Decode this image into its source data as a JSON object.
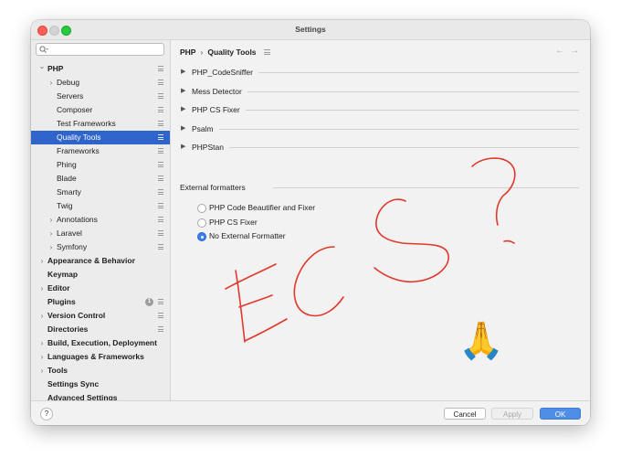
{
  "window": {
    "title": "Settings"
  },
  "sidebar": {
    "search_placeholder": "",
    "items": [
      {
        "label": "PHP",
        "bold": true,
        "arrow": "open",
        "depth": 0,
        "page": true
      },
      {
        "label": "Debug",
        "arrow": "closed",
        "depth": 1,
        "page": true
      },
      {
        "label": "Servers",
        "depth": 1,
        "page": true
      },
      {
        "label": "Composer",
        "depth": 1,
        "page": true
      },
      {
        "label": "Test Frameworks",
        "depth": 1,
        "page": true
      },
      {
        "label": "Quality Tools",
        "depth": 1,
        "page": true,
        "selected": true
      },
      {
        "label": "Frameworks",
        "depth": 1,
        "page": true
      },
      {
        "label": "Phing",
        "depth": 1,
        "page": true
      },
      {
        "label": "Blade",
        "depth": 1,
        "page": true
      },
      {
        "label": "Smarty",
        "depth": 1,
        "page": true
      },
      {
        "label": "Twig",
        "depth": 1,
        "page": true
      },
      {
        "label": "Annotations",
        "arrow": "closed",
        "depth": 1,
        "page": true
      },
      {
        "label": "Laravel",
        "arrow": "closed",
        "depth": 1,
        "page": true
      },
      {
        "label": "Symfony",
        "arrow": "closed",
        "depth": 1,
        "page": true
      },
      {
        "label": "Appearance & Behavior",
        "bold": true,
        "arrow": "closed",
        "depth": 0
      },
      {
        "label": "Keymap",
        "bold": true,
        "depth": 0
      },
      {
        "label": "Editor",
        "bold": true,
        "arrow": "closed",
        "depth": 0
      },
      {
        "label": "Plugins",
        "bold": true,
        "depth": 0,
        "page": true,
        "badge": "1"
      },
      {
        "label": "Version Control",
        "bold": true,
        "arrow": "closed",
        "depth": 0,
        "page": true
      },
      {
        "label": "Directories",
        "bold": true,
        "depth": 0,
        "page": true
      },
      {
        "label": "Build, Execution, Deployment",
        "bold": true,
        "arrow": "closed",
        "depth": 0
      },
      {
        "label": "Languages & Frameworks",
        "bold": true,
        "arrow": "closed",
        "depth": 0
      },
      {
        "label": "Tools",
        "bold": true,
        "arrow": "closed",
        "depth": 0
      },
      {
        "label": "Settings Sync",
        "bold": true,
        "depth": 0
      },
      {
        "label": "Advanced Settings",
        "bold": true,
        "depth": 0
      }
    ]
  },
  "breadcrumb": {
    "parent": "PHP",
    "separator": "›",
    "current": "Quality Tools"
  },
  "nav": {
    "back": "←",
    "forward": "→"
  },
  "sections": [
    {
      "label": "PHP_CodeSniffer"
    },
    {
      "label": "Mess Detector"
    },
    {
      "label": "PHP CS Fixer"
    },
    {
      "label": "Psalm"
    },
    {
      "label": "PHPStan"
    }
  ],
  "external_formatters": {
    "title": "External formatters",
    "options": [
      {
        "label": "PHP Code Beautifier and Fixer",
        "checked": false
      },
      {
        "label": "PHP CS Fixer",
        "checked": false
      },
      {
        "label": "No External Formatter",
        "checked": true
      }
    ]
  },
  "annotation": {
    "text": "ECS",
    "mark": "?",
    "emoji": "🙏",
    "color": "#e0392b"
  },
  "footer": {
    "help": "?",
    "cancel": "Cancel",
    "apply": "Apply",
    "ok": "OK"
  },
  "colors": {
    "selection": "#2f65ca",
    "ok_button": "#4e8ee6",
    "annotation": "#e0392b"
  }
}
